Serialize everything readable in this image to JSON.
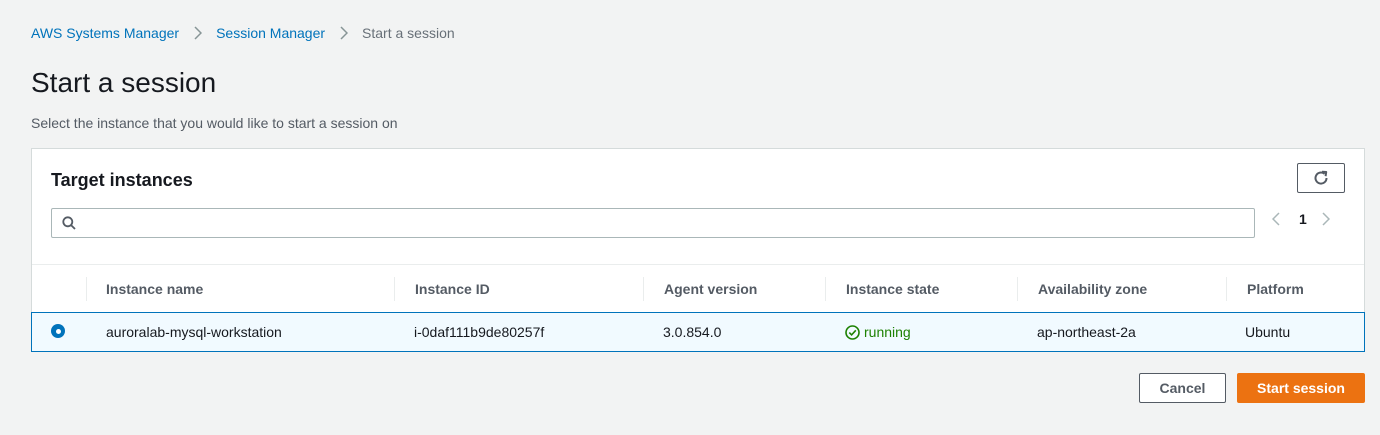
{
  "breadcrumb": {
    "items": [
      {
        "label": "AWS Systems Manager"
      },
      {
        "label": "Session Manager"
      },
      {
        "label": "Start a session"
      }
    ]
  },
  "page": {
    "title": "Start a session",
    "description": "Select the instance that you would like to start a session on"
  },
  "panel": {
    "title": "Target instances",
    "search": {
      "value": "",
      "placeholder": ""
    },
    "pagination": {
      "current_page": "1"
    }
  },
  "table": {
    "columns": [
      "Instance name",
      "Instance ID",
      "Agent version",
      "Instance state",
      "Availability zone",
      "Platform"
    ],
    "rows": [
      {
        "selected": true,
        "instance_name": "auroralab-mysql-workstation",
        "instance_id": "i-0daf111b9de80257f",
        "agent_version": "3.0.854.0",
        "instance_state": "running",
        "availability_zone": "ap-northeast-2a",
        "platform": "Ubuntu"
      }
    ]
  },
  "footer": {
    "cancel_label": "Cancel",
    "start_label": "Start session"
  },
  "icons": {
    "breadcrumb_separator": "chevron-right-icon",
    "refresh": "refresh-icon",
    "search": "search-icon",
    "prev_page": "chevron-left-icon",
    "next_page": "chevron-right-icon",
    "state": "check-circle-icon"
  },
  "colors": {
    "link": "#0073bb",
    "primary_button": "#ec7211",
    "running": "#1d8102",
    "selected_row_bg": "#f1faff",
    "selected_row_border": "#0073bb"
  }
}
